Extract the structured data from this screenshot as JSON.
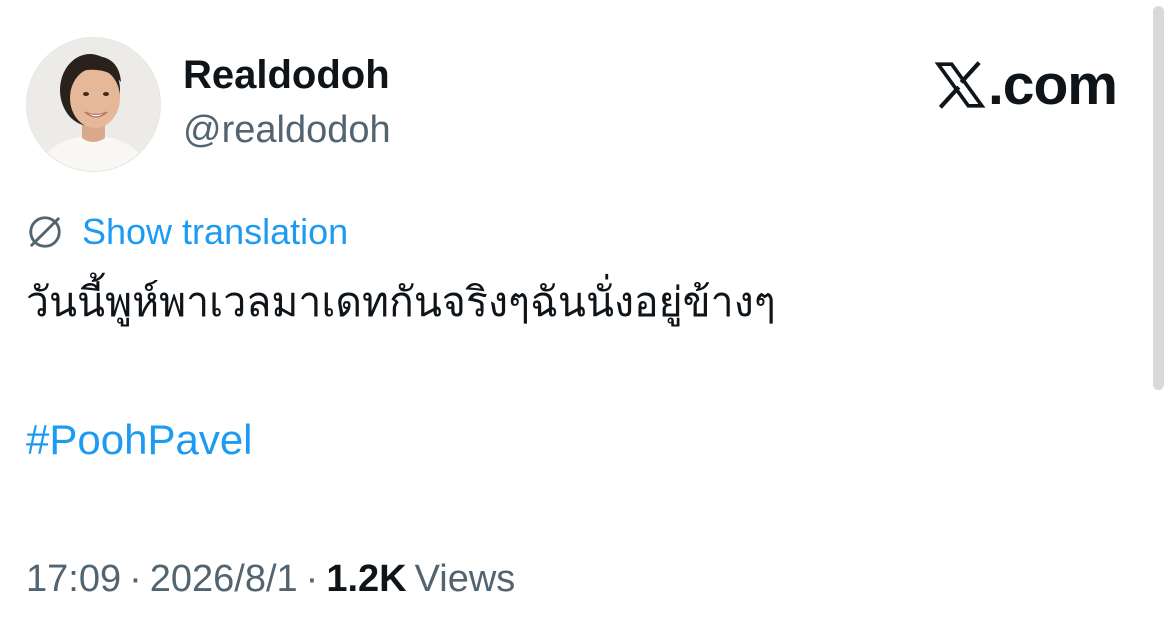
{
  "author": {
    "display_name": "Realdodoh",
    "handle": "@realdodoh"
  },
  "brand": {
    "text": ".com",
    "icon": "x-logo-icon"
  },
  "translation": {
    "icon": "globe-icon",
    "label": "Show translation"
  },
  "tweet": {
    "text": "วันนี้พูห์พาเวลมาเดทกันจริงๆฉันนั่งอยู่ข้างๆ",
    "hashtag": "#PoohPavel"
  },
  "meta": {
    "time": "17:09",
    "separator1": "·",
    "date": "2026/8/1",
    "separator2": "·",
    "views_count": "1.2K",
    "views_label": "Views"
  },
  "colors": {
    "link": "#1d9bf0",
    "secondary_text": "#536471",
    "primary_text": "#0f1419"
  }
}
